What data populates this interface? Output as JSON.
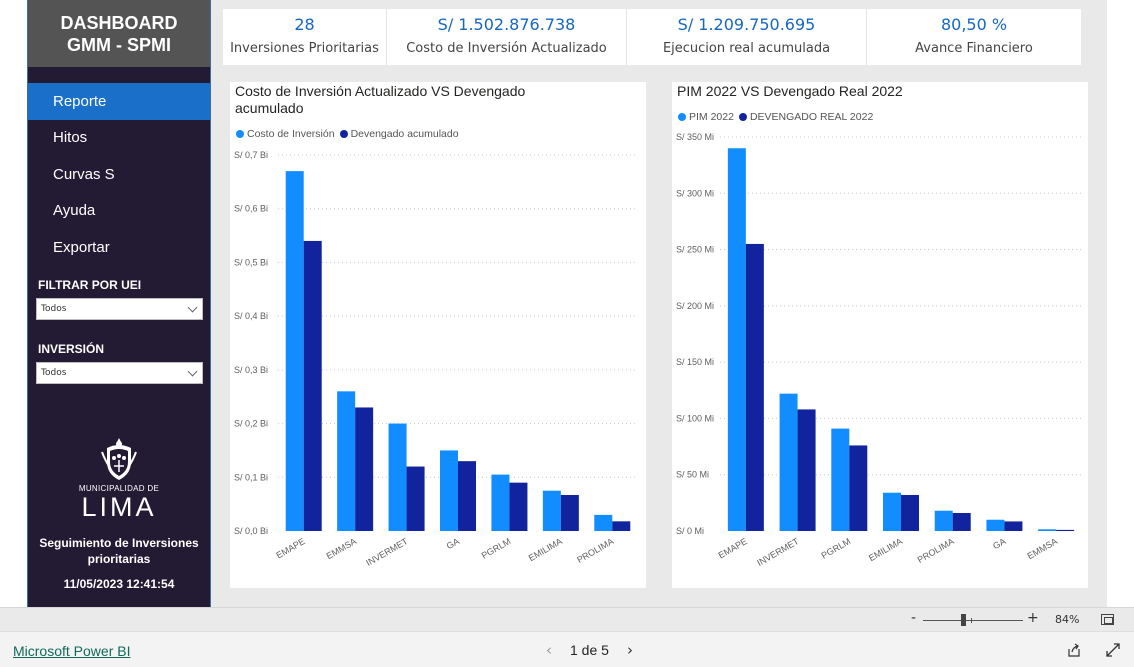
{
  "sidebar": {
    "title_line1": "DASHBOARD",
    "title_line2": "GMM - SPMI",
    "nav": [
      "Reporte",
      "Hitos",
      "Curvas S",
      "Ayuda",
      "Exportar"
    ],
    "active_index": 0,
    "filter_uei_label": "FILTRAR POR UEI",
    "filter_uei_value": "Todos",
    "filter_inv_label": "INVERSIÓN",
    "filter_inv_value": "Todos",
    "logo_muni": "MUNICIPALIDAD DE",
    "logo_lima": "LIMA",
    "subtitle": "Seguimiento de Inversiones prioritarias",
    "datetime": "11/05/2023 12:41:54"
  },
  "kpis": [
    {
      "value": "28",
      "label": "Inversiones Prioritarias"
    },
    {
      "value": "S/ 1.502.876.738",
      "label": "Costo de Inversión Actualizado"
    },
    {
      "value": "S/ 1.209.750.695",
      "label": "Ejecucion real acumulada"
    },
    {
      "value": "80,50 %",
      "label": "Avance Financiero"
    }
  ],
  "colors": {
    "series_light": "#118dff",
    "series_dark": "#12239e",
    "sidebar_bg": "#231a33",
    "active_nav": "#1a6fc8",
    "kpi_value": "#1467c2"
  },
  "chart_data": [
    {
      "type": "bar",
      "title": "Costo de Inversión Actualizado VS Devengado acumulado",
      "categories": [
        "EMAPE",
        "EMMSA",
        "INVERMET",
        "GA",
        "PGRLM",
        "EMILIMA",
        "PROLIMA"
      ],
      "series": [
        {
          "name": "Costo de Inversión",
          "values": [
            0.67,
            0.26,
            0.2,
            0.15,
            0.105,
            0.075,
            0.03
          ]
        },
        {
          "name": "Devengado acumulado",
          "values": [
            0.54,
            0.23,
            0.12,
            0.13,
            0.09,
            0.067,
            0.018
          ]
        }
      ],
      "ylim": [
        0,
        0.7
      ],
      "yticks": [
        0,
        0.1,
        0.2,
        0.3,
        0.4,
        0.5,
        0.6,
        0.7
      ],
      "ytick_labels": [
        "S/ 0,0 Bi",
        "S/ 0,1 Bi",
        "S/ 0,2 Bi",
        "S/ 0,3 Bi",
        "S/ 0,4 Bi",
        "S/ 0,5 Bi",
        "S/ 0,6 Bi",
        "S/ 0,7 Bi"
      ],
      "grid": true,
      "legend": "top-left"
    },
    {
      "type": "bar",
      "title": "PIM 2022 VS Devengado Real 2022",
      "categories": [
        "EMAPE",
        "INVERMET",
        "PGRLM",
        "EMILIMA",
        "PROLIMA",
        "GA",
        "EMMSA"
      ],
      "series": [
        {
          "name": "PIM 2022",
          "values": [
            340,
            122,
            91,
            34,
            18,
            10,
            1.5
          ]
        },
        {
          "name": "DEVENGADO REAL 2022",
          "values": [
            255,
            108,
            76,
            32,
            16,
            8.5,
            1
          ]
        }
      ],
      "ylim": [
        0,
        350
      ],
      "yticks": [
        0,
        50,
        100,
        150,
        200,
        250,
        300,
        350
      ],
      "ytick_labels": [
        "S/ 0 Mi",
        "S/ 50 Mi",
        "S/ 100 Mi",
        "S/ 150 Mi",
        "S/ 200 Mi",
        "S/ 250 Mi",
        "S/ 300 Mi",
        "S/ 350 Mi"
      ],
      "grid": true,
      "legend": "top-left"
    }
  ],
  "zoom": {
    "minus": "-",
    "plus": "+",
    "percent": "84%"
  },
  "footer": {
    "link": "Microsoft Power BI",
    "page_text": "1 de 5",
    "prev": "‹",
    "next": "›"
  }
}
